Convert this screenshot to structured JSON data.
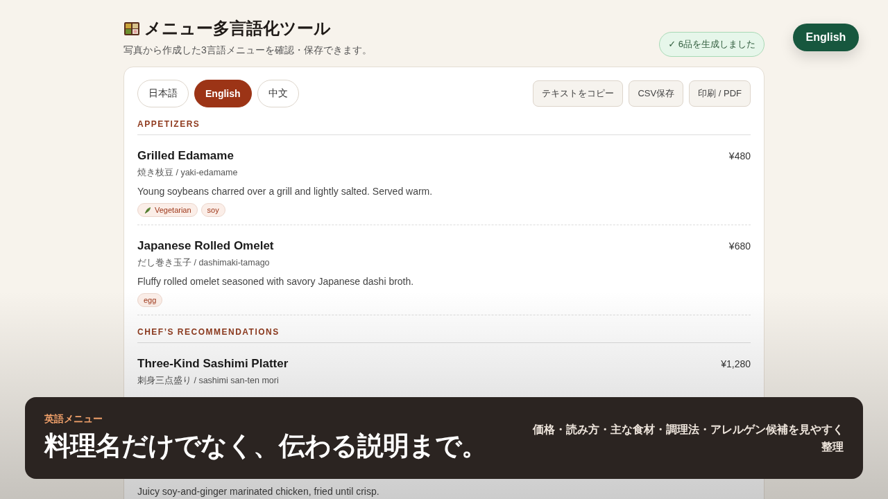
{
  "header": {
    "title": "メニュー多言語化ツール",
    "subtitle": "写真から作成した3言語メニューを確認・保存できます。",
    "status": "✓ 6品を生成しました"
  },
  "floating_button": {
    "label": "English"
  },
  "language_tabs": [
    {
      "label": "日本語",
      "selected": false
    },
    {
      "label": "English",
      "selected": true
    },
    {
      "label": "中文",
      "selected": false
    }
  ],
  "actions": [
    "テキストをコピー",
    "CSV保存",
    "印刷 / PDF"
  ],
  "sections": [
    {
      "heading": "APPETIZERS",
      "items": [
        {
          "name": "Grilled Edamame",
          "price": "¥480",
          "reading": "焼き枝豆 / yaki-edamame",
          "description": "Young soybeans charred over a grill and lightly salted. Served warm.",
          "tags": [
            {
              "kind": "diet",
              "label": "Vegetarian"
            },
            {
              "kind": "allergen",
              "label": "soy"
            }
          ]
        },
        {
          "name": "Japanese Rolled Omelet",
          "price": "¥680",
          "reading": "だし巻き玉子 / dashimaki-tamago",
          "description": "Fluffy rolled omelet seasoned with savory Japanese dashi broth.",
          "tags": [
            {
              "kind": "allergen",
              "label": "egg"
            }
          ]
        }
      ]
    },
    {
      "heading": "CHEF’S RECOMMENDATIONS",
      "items": [
        {
          "name": "Three-Kind Sashimi Platter",
          "price": "¥1,280",
          "reading": "刺身三点盛り / sashimi san-ten mori"
        },
        {
          "description": "Juicy soy-and-ginger marinated chicken, fried until crisp."
        }
      ]
    }
  ],
  "banner": {
    "label": "英語メニュー",
    "headline": "料理名だけでなく、伝わる説明まで。",
    "note": "価格・読み方・主な食材・調理法・アレルゲン候補を見やすく整理"
  }
}
